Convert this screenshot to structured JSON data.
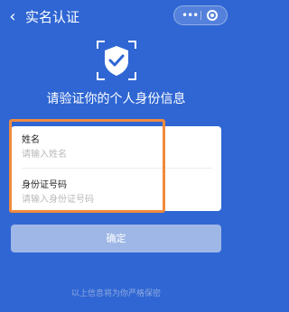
{
  "topbar": {
    "back_icon": "chevron-left-icon",
    "title": "实名认证",
    "capsule": {
      "more_icon": "more-dots-icon",
      "close_icon": "target-icon"
    }
  },
  "hero": {
    "icon": "shield-check-icon",
    "heading": "请验证你的个人身份信息"
  },
  "form": {
    "name": {
      "label": "姓名",
      "placeholder": "请输入姓名"
    },
    "id_number": {
      "label": "身份证号码",
      "placeholder": "请输入身份证号码"
    }
  },
  "confirm_label": "确定",
  "footer_text": "以上信息将为你严格保密",
  "colors": {
    "background": "#2f66d3",
    "highlight": "#f08a3d",
    "button": "#9fb7e6"
  }
}
